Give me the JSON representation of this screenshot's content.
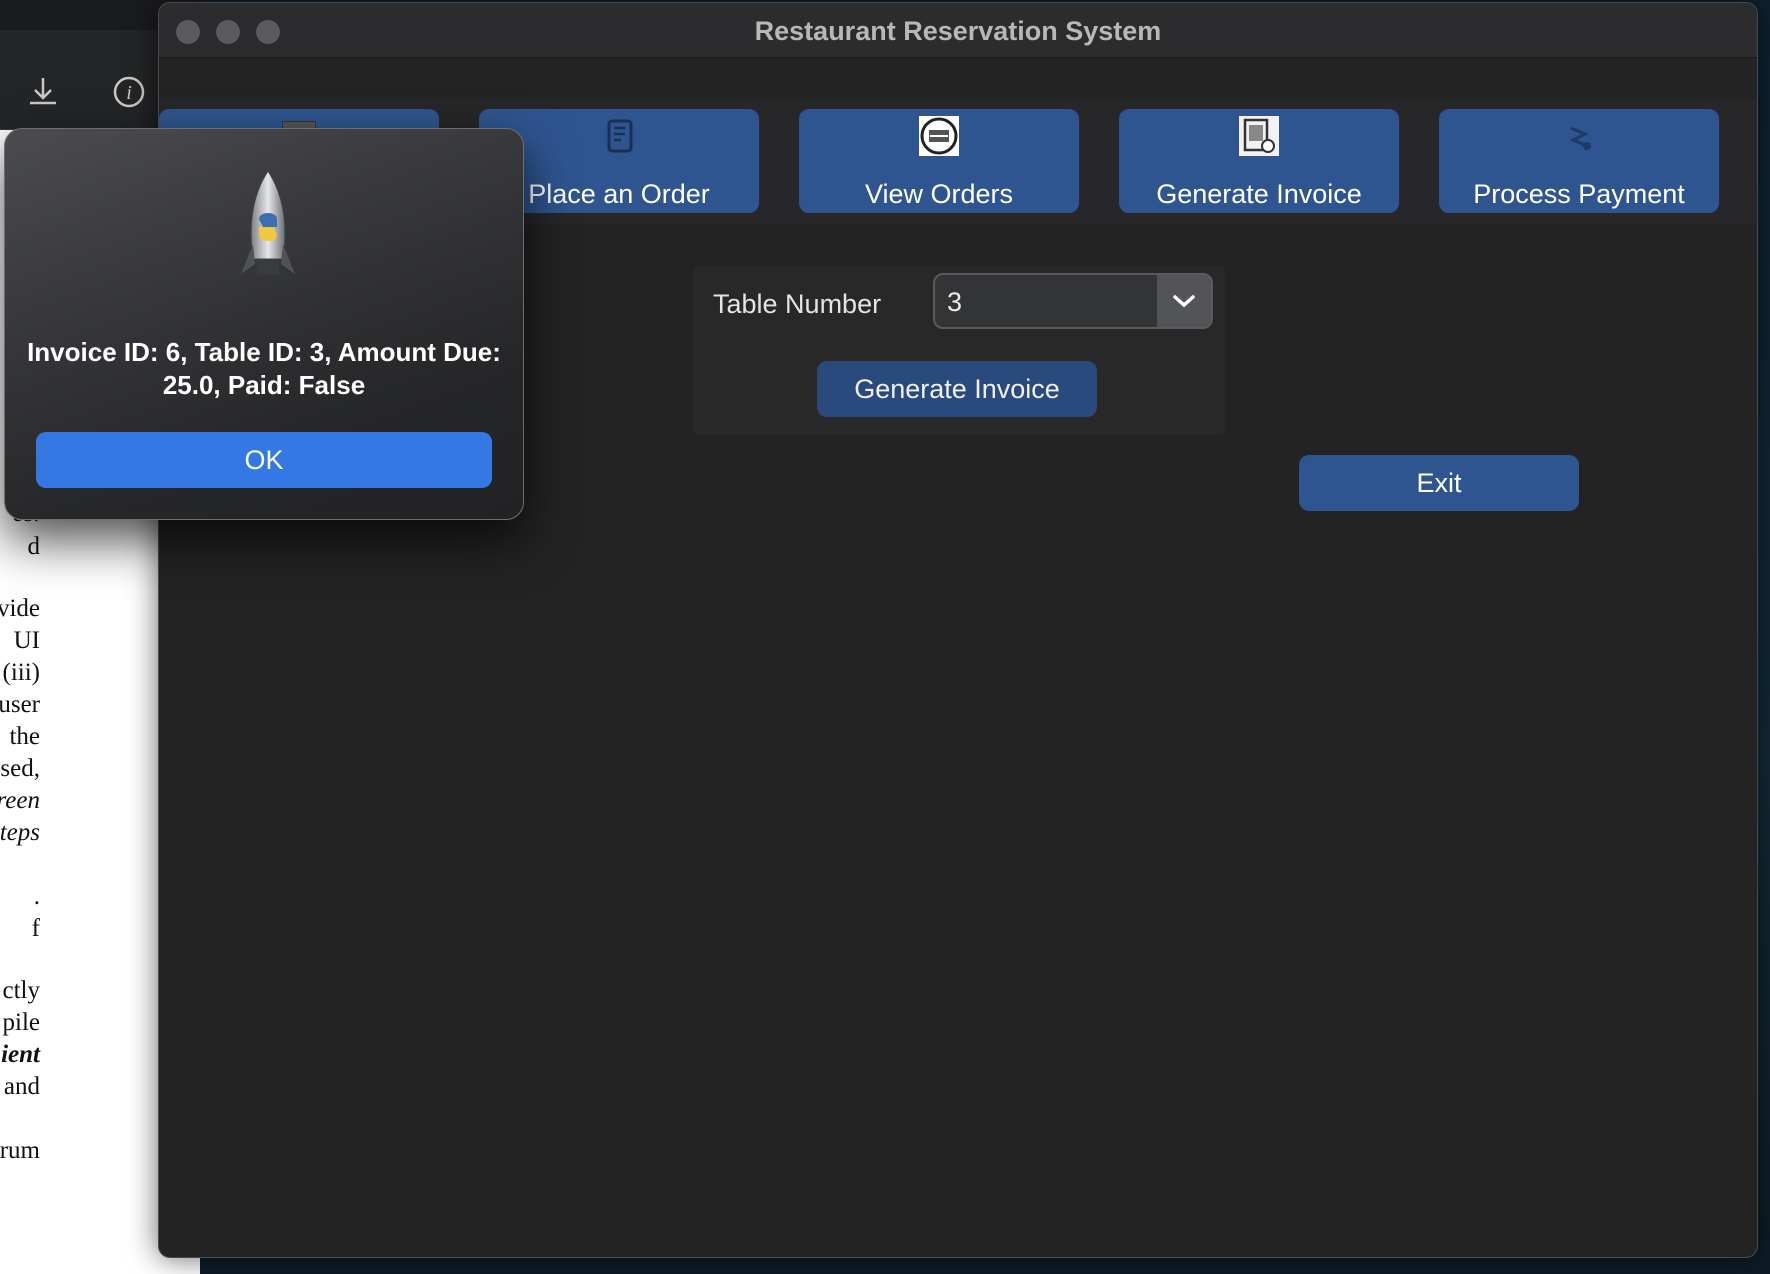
{
  "window": {
    "title": "Restaurant Reservation System"
  },
  "tabs": [
    {
      "label": "",
      "icon": "calendar-icon"
    },
    {
      "label": "Place an Order",
      "icon": "order-icon"
    },
    {
      "label": "View Orders",
      "icon": "orders-list-icon"
    },
    {
      "label": "Generate Invoice",
      "icon": "invoice-icon"
    },
    {
      "label": "Process Payment",
      "icon": "payment-icon"
    }
  ],
  "invoice_form": {
    "table_number_label": "Table Number",
    "table_number_value": "3",
    "generate_button": "Generate Invoice"
  },
  "exit_button": "Exit",
  "alert": {
    "message": "Invoice ID: 6, Table ID: 3, Amount Due: 25.0, Paid: False",
    "ok_button": "OK",
    "icon": "python-rocket-icon"
  },
  "background_document": {
    "lines": [
      {
        "text": "es.",
        "style": "i"
      },
      {
        "text": "d",
        "style": ""
      },
      {
        "text": "vide",
        "style": ""
      },
      {
        "text": "UI",
        "style": ""
      },
      {
        "text": "(iii)",
        "style": ""
      },
      {
        "text": "user",
        "style": ""
      },
      {
        "text": "the",
        "style": ""
      },
      {
        "text": "sed,",
        "style": ""
      },
      {
        "text": "reen",
        "style": "i"
      },
      {
        "text": "teps",
        "style": "i"
      },
      {
        "text": ".",
        "style": ""
      },
      {
        "text": "f",
        "style": ""
      },
      {
        "text": "ctly",
        "style": ""
      },
      {
        "text": "pile",
        "style": ""
      },
      {
        "text": "ient",
        "style": "bi"
      },
      {
        "text": "and",
        "style": ""
      },
      {
        "text": "rum",
        "style": ""
      }
    ]
  },
  "colors": {
    "tab_blue": "#2f5590",
    "ok_blue": "#3478e3",
    "window_bg": "#232324"
  }
}
